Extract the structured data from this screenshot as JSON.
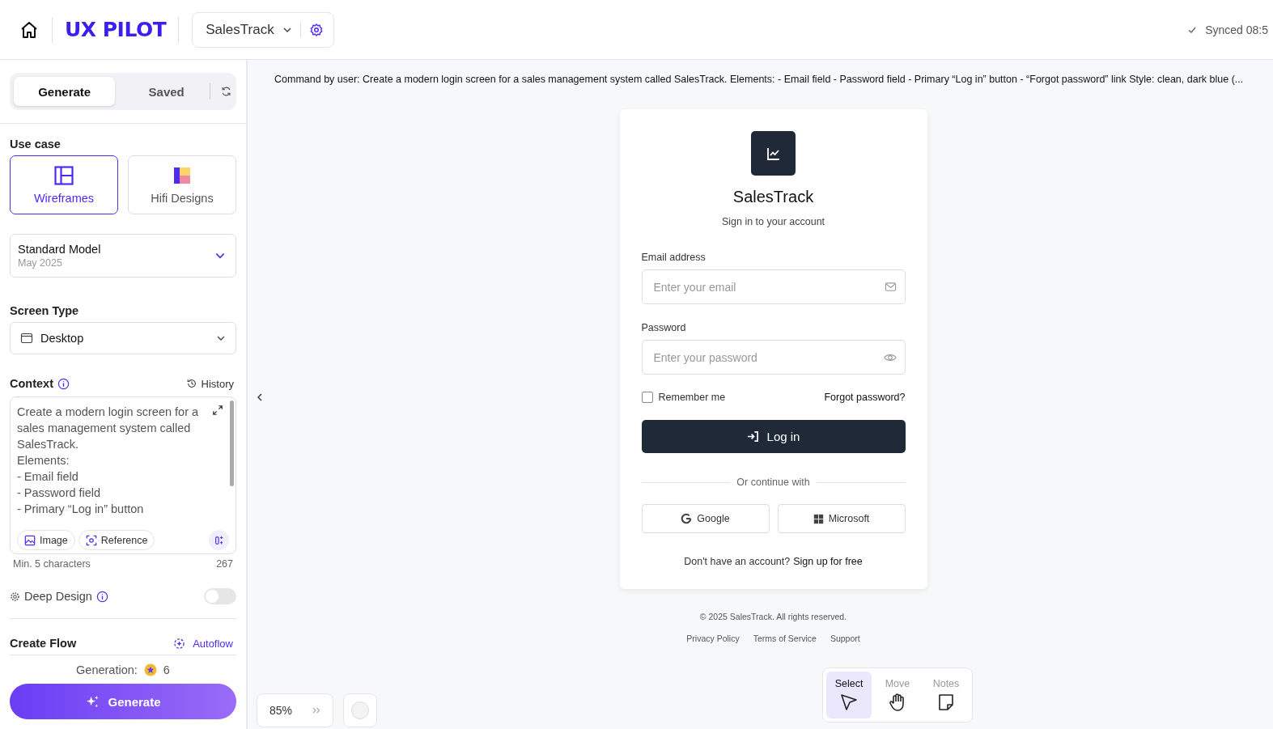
{
  "header": {
    "brand": "UX PILOT",
    "project": "SalesTrack",
    "sync": "Synced 08:5"
  },
  "sidebar": {
    "tabs": [
      {
        "label": "Generate",
        "selected": true
      },
      {
        "label": "Saved",
        "selected": false
      }
    ],
    "use_case": {
      "label": "Use case",
      "options": [
        {
          "label": "Wireframes",
          "selected": true,
          "kind": "wireframe"
        },
        {
          "label": "Hifi Designs",
          "selected": false,
          "kind": "hifi"
        }
      ]
    },
    "model": {
      "name": "Standard Model",
      "date": "May 2025"
    },
    "screen_type": {
      "label": "Screen Type",
      "value": "Desktop"
    },
    "context": {
      "label": "Context",
      "history": "History",
      "lines": [
        "Create a modern login screen for a",
        "sales management system called",
        "SalesTrack.",
        "Elements:",
        "- Email field",
        "- Password field",
        "- Primary “Log in” button"
      ],
      "attachments": [
        {
          "label": "Image",
          "kind": "image"
        },
        {
          "label": "Reference",
          "kind": "reference"
        }
      ],
      "hint": "Min. 5 characters",
      "count": "267"
    },
    "deep_design": {
      "label": "Deep Design",
      "on": false
    },
    "create_flow": {
      "label": "Create Flow",
      "autoflow": "Autoflow"
    },
    "generation": {
      "label": "Generation:",
      "count": "6"
    },
    "generate_button": "Generate"
  },
  "canvas": {
    "command": "Command by user: Create a modern login screen for a sales management system called SalesTrack. Elements: - Email field - Password field - Primary “Log in” button - “Forgot password” link Style: clean, dark blue (...",
    "login": {
      "title": "SalesTrack",
      "subtitle": "Sign in to your account",
      "email_label": "Email address",
      "email_placeholder": "Enter your email",
      "password_label": "Password",
      "password_placeholder": "Enter your password",
      "remember": {
        "label": "Remember me",
        "checked": false
      },
      "forgot": "Forgot password?",
      "login_button": "Log in",
      "divider": "Or continue with",
      "social": [
        {
          "label": "Google",
          "kind": "google"
        },
        {
          "label": "Microsoft",
          "kind": "microsoft"
        }
      ],
      "signup_prompt": "Don't have an account?",
      "signup_link": "Sign up for free"
    },
    "footer": {
      "copyright": "© 2025 SalesTrack. All rights reserved.",
      "links": [
        "Privacy Policy",
        "Terms of Service",
        "Support"
      ]
    },
    "zoom": "85%",
    "tools": [
      {
        "label": "Select",
        "selected": true,
        "kind": "select"
      },
      {
        "label": "Move",
        "selected": false,
        "kind": "move"
      },
      {
        "label": "Notes",
        "selected": false,
        "kind": "notes"
      }
    ]
  }
}
